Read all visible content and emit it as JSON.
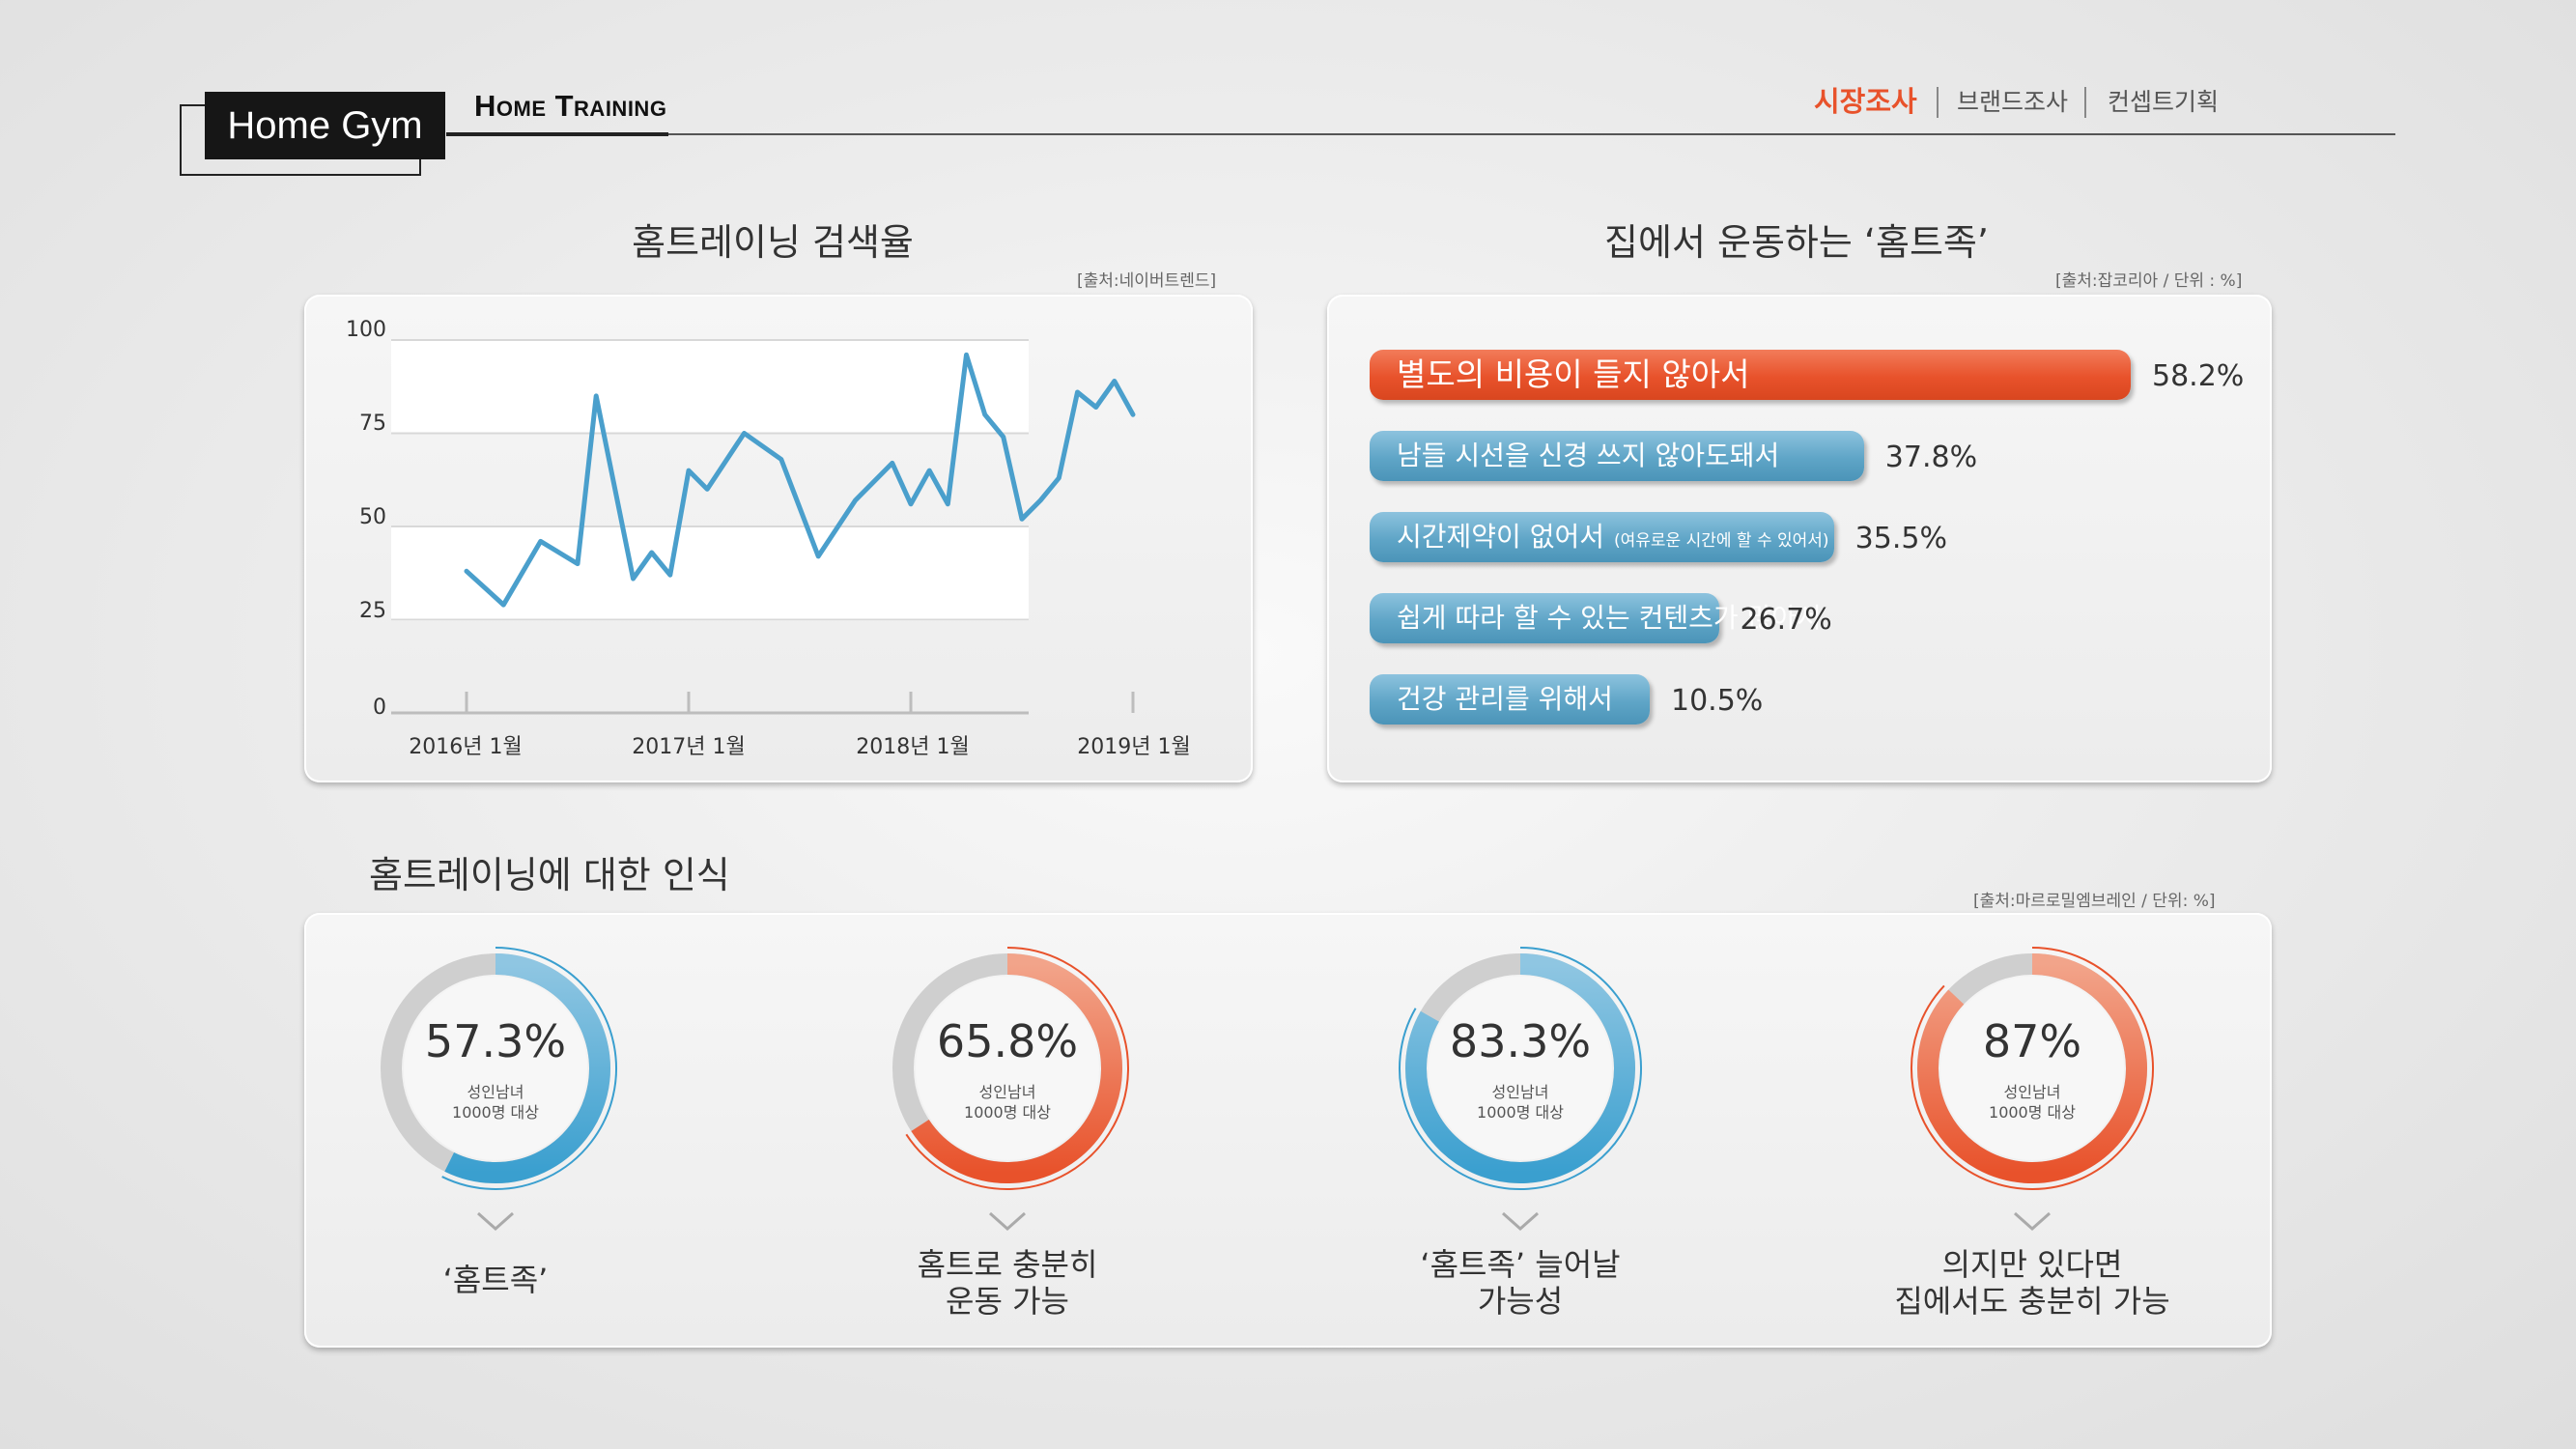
{
  "header": {
    "logo": "Home Gym",
    "subtitle": "Home Training",
    "nav": [
      "시장조사",
      "브랜드조사",
      "컨셉트기획"
    ]
  },
  "search_chart": {
    "title": "홈트레이닝 검색율",
    "source": "[출처:네이버트렌드]"
  },
  "bar_section": {
    "title": "집에서 운동하는 ‘홈트족’",
    "source": "[출처:잡코리아 / 단위 : %]",
    "bars": [
      {
        "label": "별도의 비용이 들지 않아서",
        "note": "",
        "value": "58.2%"
      },
      {
        "label": "남들 시선을 신경 쓰지 않아도돼서",
        "note": "",
        "value": "37.8%"
      },
      {
        "label": "시간제약이 없어서",
        "note": "(여유로운 시간에 할 수 있어서)",
        "value": "35.5%"
      },
      {
        "label": "쉽게 따라 할 수 있는 컨텐츠가 많아서",
        "note": "",
        "value": "26.7%"
      },
      {
        "label": "건강 관리를 위해서",
        "note": "",
        "value": "10.5%"
      }
    ],
    "colors": {
      "highlight": "#e8522b",
      "normal": "#5fa5c7"
    }
  },
  "perception": {
    "title": "홈트레이닝에 대한 인식",
    "source": "[출처:마르로밀엠브레인 / 단위: %]",
    "items": [
      {
        "value": "57.3%",
        "sub1": "성인남녀",
        "sub2": "1000명 대상",
        "caption1": "‘홈트족’",
        "caption2": "",
        "color": "#3a9fcf"
      },
      {
        "value": "65.8%",
        "sub1": "성인남녀",
        "sub2": "1000명 대상",
        "caption1": "홈트로 충분히",
        "caption2": "운동 가능",
        "color": "#e8522b"
      },
      {
        "value": "83.3%",
        "sub1": "성인남녀",
        "sub2": "1000명 대상",
        "caption1": "‘홈트족’ 늘어날",
        "caption2": "가능성",
        "color": "#3a9fcf"
      },
      {
        "value": "87%",
        "sub1": "성인남녀",
        "sub2": "1000명 대상",
        "caption1": "의지만 있다면",
        "caption2": "집에서도 충분히 가능",
        "color": "#e8522b"
      }
    ]
  },
  "chart_data": [
    {
      "type": "line",
      "title": "홈트레이닝 검색율",
      "ylim": [
        0,
        100
      ],
      "yticks": [
        "0",
        "25",
        "50",
        "75",
        "100"
      ],
      "xtick_labels": [
        "2016년 1월",
        "2017년 1월",
        "2018년 1월",
        "2019년 1월"
      ],
      "grid": true,
      "series": [
        {
          "color": "#4a9fcc",
          "x": [
            "2016-01",
            "2016-03",
            "2016-05",
            "2016-07",
            "2016-08",
            "2016-10",
            "2016-11",
            "2016-12",
            "2017-01",
            "2017-02",
            "2017-04",
            "2017-06",
            "2017-08",
            "2017-10",
            "2017-12",
            "2018-01",
            "2018-02",
            "2018-03",
            "2018-04",
            "2018-05",
            "2018-06",
            "2018-07",
            "2018-08",
            "2018-09",
            "2018-10",
            "2018-11",
            "2018-12",
            "2019-01"
          ],
          "y": [
            38,
            29,
            46,
            40,
            85,
            36,
            43,
            37,
            65,
            60,
            75,
            68,
            42,
            57,
            67,
            56,
            65,
            56,
            96,
            80,
            74,
            52,
            57,
            63,
            86,
            82,
            89,
            80
          ]
        }
      ]
    },
    {
      "type": "bar",
      "orientation": "horizontal",
      "categories": [
        "별도의 비용이 들지 않아서",
        "남들 시선을 신경 쓰지 않아도돼서",
        "시간제약이 없어서 (여유로운 시간에 할 수 있어서)",
        "쉽게 따라 할 수 있는 컨텐츠가 많아서",
        "건강 관리를 위해서"
      ],
      "values": [
        58.2,
        37.8,
        35.5,
        26.7,
        10.5
      ]
    },
    {
      "type": "pie",
      "variant": "donut",
      "categories": [
        "‘홈트족’",
        "홈트로 충분히 운동 가능",
        "‘홈트족’ 늘어날 가능성",
        "의지만 있다면 집에서도 충분히 가능"
      ],
      "values": [
        57.3,
        65.8,
        83.3,
        87
      ]
    }
  ]
}
